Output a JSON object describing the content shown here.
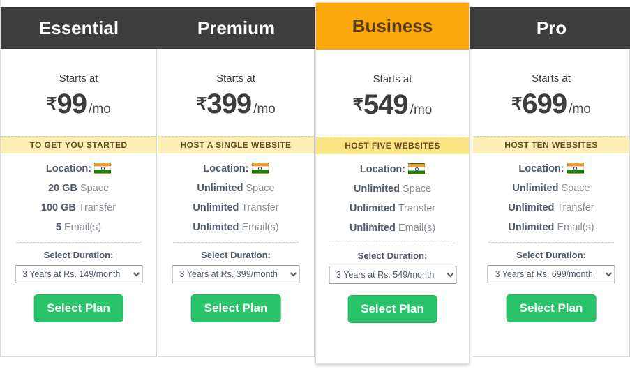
{
  "colors": {
    "header_dark": "#3d3d3d",
    "featured_accent": "#FAA80B",
    "tagline_bg": "#fcefb6",
    "tagline_bg_featured": "#fbe484",
    "button_green": "#29c46a",
    "feature_value": "#50596a",
    "feature_label": "#8a8f96"
  },
  "labels": {
    "starts_at": "Starts at",
    "currency_symbol": "₹",
    "per_month": "/mo",
    "location_label": "Location:",
    "select_duration_label": "Select Duration:",
    "select_plan_label": "Select Plan",
    "flag_icon": "india-flag-icon"
  },
  "plans": [
    {
      "name": "Essential",
      "featured": false,
      "price": "99",
      "tagline": "TO GET YOU STARTED",
      "features": [
        {
          "value": "20 GB",
          "label": "Space"
        },
        {
          "value": "100 GB",
          "label": "Transfer"
        },
        {
          "value": "5",
          "label": "Email(s)"
        }
      ],
      "duration_selected": "3 Years at Rs. 149/month",
      "duration_options": [
        "3 Years at Rs. 149/month"
      ]
    },
    {
      "name": "Premium",
      "featured": false,
      "price": "399",
      "tagline": "HOST A SINGLE WEBSITE",
      "features": [
        {
          "value": "Unlimited",
          "label": "Space"
        },
        {
          "value": "Unlimited",
          "label": "Transfer"
        },
        {
          "value": "Unlimited",
          "label": "Email(s)"
        }
      ],
      "duration_selected": "3 Years at Rs. 399/month",
      "duration_options": [
        "3 Years at Rs. 399/month"
      ]
    },
    {
      "name": "Business",
      "featured": true,
      "price": "549",
      "tagline": "HOST FIVE WEBSITES",
      "features": [
        {
          "value": "Unlimited",
          "label": "Space"
        },
        {
          "value": "Unlimited",
          "label": "Transfer"
        },
        {
          "value": "Unlimited",
          "label": "Email(s)"
        }
      ],
      "duration_selected": "3 Years at Rs. 549/month",
      "duration_options": [
        "3 Years at Rs. 549/month"
      ]
    },
    {
      "name": "Pro",
      "featured": false,
      "price": "699",
      "tagline": "HOST TEN WEBSITES",
      "features": [
        {
          "value": "Unlimited",
          "label": "Space"
        },
        {
          "value": "Unlimited",
          "label": "Transfer"
        },
        {
          "value": "Unlimited",
          "label": "Email(s)"
        }
      ],
      "duration_selected": "3 Years at Rs. 699/month",
      "duration_options": [
        "3 Years at Rs. 699/month"
      ]
    }
  ]
}
